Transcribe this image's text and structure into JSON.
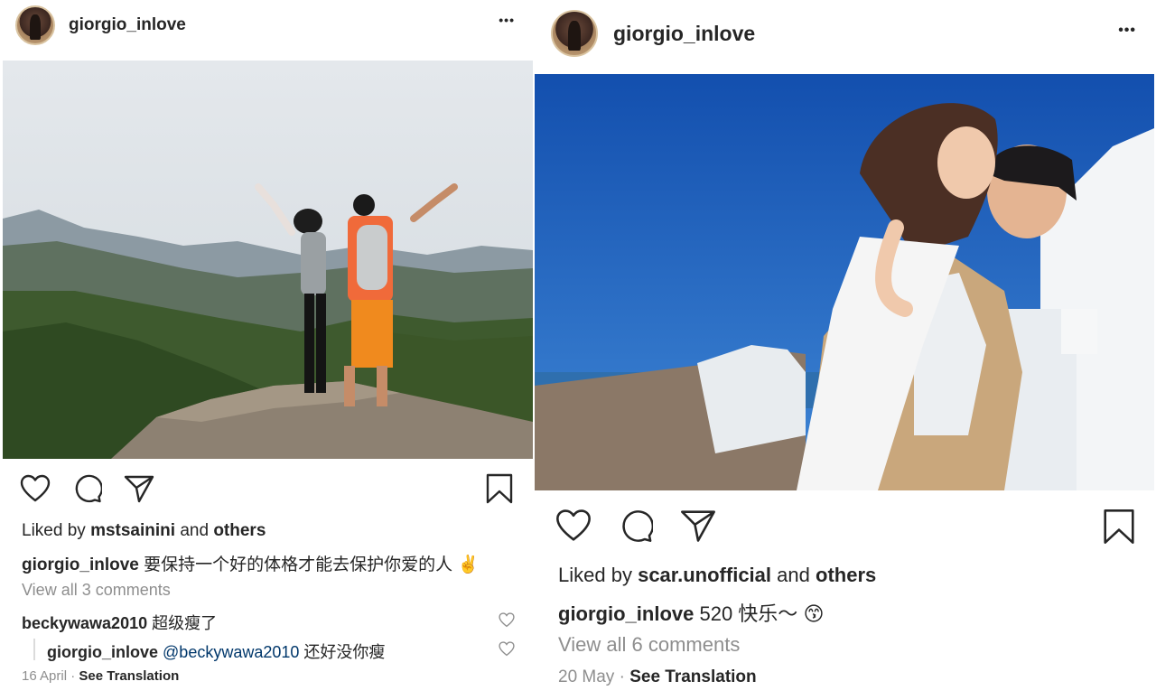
{
  "left_post": {
    "username": "giorgio_inlove",
    "more_label": "•••",
    "liked_prefix": "Liked by",
    "liked_user": "mstsainini",
    "liked_and": "and",
    "liked_others": "others",
    "caption_user": "giorgio_inlove",
    "caption_text": "要保持一个好的体格才能去保护你爱的人",
    "caption_emoji": "✌️",
    "view_comments": "View all 3 comments",
    "comments": [
      {
        "user": "beckywawa2010",
        "text": "超级瘦了"
      },
      {
        "user": "giorgio_inlove",
        "mention": "@beckywawa2010",
        "text": "还好没你瘦"
      }
    ],
    "date": "16 April",
    "separator": "·",
    "see_translation": "See Translation"
  },
  "right_post": {
    "username": "giorgio_inlove",
    "more_label": "•••",
    "liked_prefix": "Liked by",
    "liked_user": "scar.unofficial",
    "liked_and": "and",
    "liked_others": "others",
    "caption_user": "giorgio_inlove",
    "caption_text": "520 快乐～",
    "caption_emoji": "😙",
    "view_comments": "View all 6 comments",
    "date": "20 May",
    "separator": "·",
    "see_translation": "See Translation"
  },
  "icons": [
    "heart-icon",
    "comment-icon",
    "share-icon",
    "bookmark-icon",
    "more-icon"
  ],
  "colors": {
    "text": "#262626",
    "muted": "#8e8e8e",
    "mention": "#00376b",
    "sky_left": "#dfe4e8",
    "sky_right": "#1a5fc0"
  }
}
